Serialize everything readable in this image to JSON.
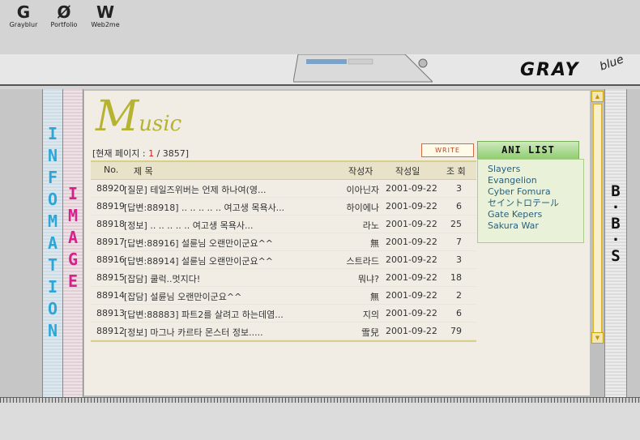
{
  "toolbar": {
    "items": [
      {
        "glyph": "G",
        "label": "Grayblur"
      },
      {
        "glyph": "Ø",
        "label": "Portfolio"
      },
      {
        "glyph": "W",
        "label": "Web2me"
      }
    ]
  },
  "brand": {
    "logo": "GRAY",
    "sub": "blue"
  },
  "side_left": {
    "info_letters": "I\nN\nF\nO\nM\nA\nT\nI\nO\nN",
    "image_letters": "I\nM\nA\nG\nE"
  },
  "side_right": {
    "bbs_letters": "B\n·\nB\n·\nS"
  },
  "board": {
    "title_initial": "M",
    "title_rest": "usic",
    "page_label_prefix": "[현재 페이지 : ",
    "page_current": "1",
    "page_label_suffix": " / 3857]",
    "write_label": "WRITE",
    "columns": {
      "no": "No.",
      "title": "제 목",
      "author": "작성자",
      "date": "작성일",
      "views": "조 회"
    },
    "rows": [
      {
        "no": "88920",
        "title": "[질문] 테일즈위버는 언제 하나여(영...",
        "author": "이아닌자",
        "date": "2001-09-22",
        "views": "3"
      },
      {
        "no": "88919",
        "title": "[답변:88918] .. .. .. .. .. 여고생 목욕사...",
        "author": "하이에나",
        "date": "2001-09-22",
        "views": "6"
      },
      {
        "no": "88918",
        "title": "[정보] .. .. .. .. .. 여고생 목욕사...",
        "author": "라노",
        "date": "2001-09-22",
        "views": "25"
      },
      {
        "no": "88917",
        "title": "[답변:88916] 설륜님 오랜만이군요^^",
        "author": "無",
        "date": "2001-09-22",
        "views": "7"
      },
      {
        "no": "88916",
        "title": "[답변:88914] 설륜님 오랜만이군요^^",
        "author": "스트라드",
        "date": "2001-09-22",
        "views": "3"
      },
      {
        "no": "88915",
        "title": "[잡담] 쿨럭..멋지다!",
        "author": "뭐냐?",
        "date": "2001-09-22",
        "views": "18"
      },
      {
        "no": "88914",
        "title": "[잡담] 설륜님 오랜만이군요^^",
        "author": "無",
        "date": "2001-09-22",
        "views": "2"
      },
      {
        "no": "88913",
        "title": "[답변:88883] 파트2를 살려고 하는데염...",
        "author": "지의",
        "date": "2001-09-22",
        "views": "6"
      },
      {
        "no": "88912",
        "title": "[정보] 마그나 카르타 몬스터 정보.....",
        "author": "雪兒",
        "date": "2001-09-22",
        "views": "79"
      }
    ]
  },
  "ani_list": {
    "title": "ANI LIST",
    "items": [
      "Slayers",
      "Evangelion",
      "Cyber Fomura",
      "セイントロテール",
      "Gate Kepers",
      "Sakura War"
    ]
  },
  "colors": {
    "accent_music": "#b5b331",
    "info_text": "#2aa7d8",
    "image_text": "#d6208a",
    "list_link": "#27607e"
  }
}
